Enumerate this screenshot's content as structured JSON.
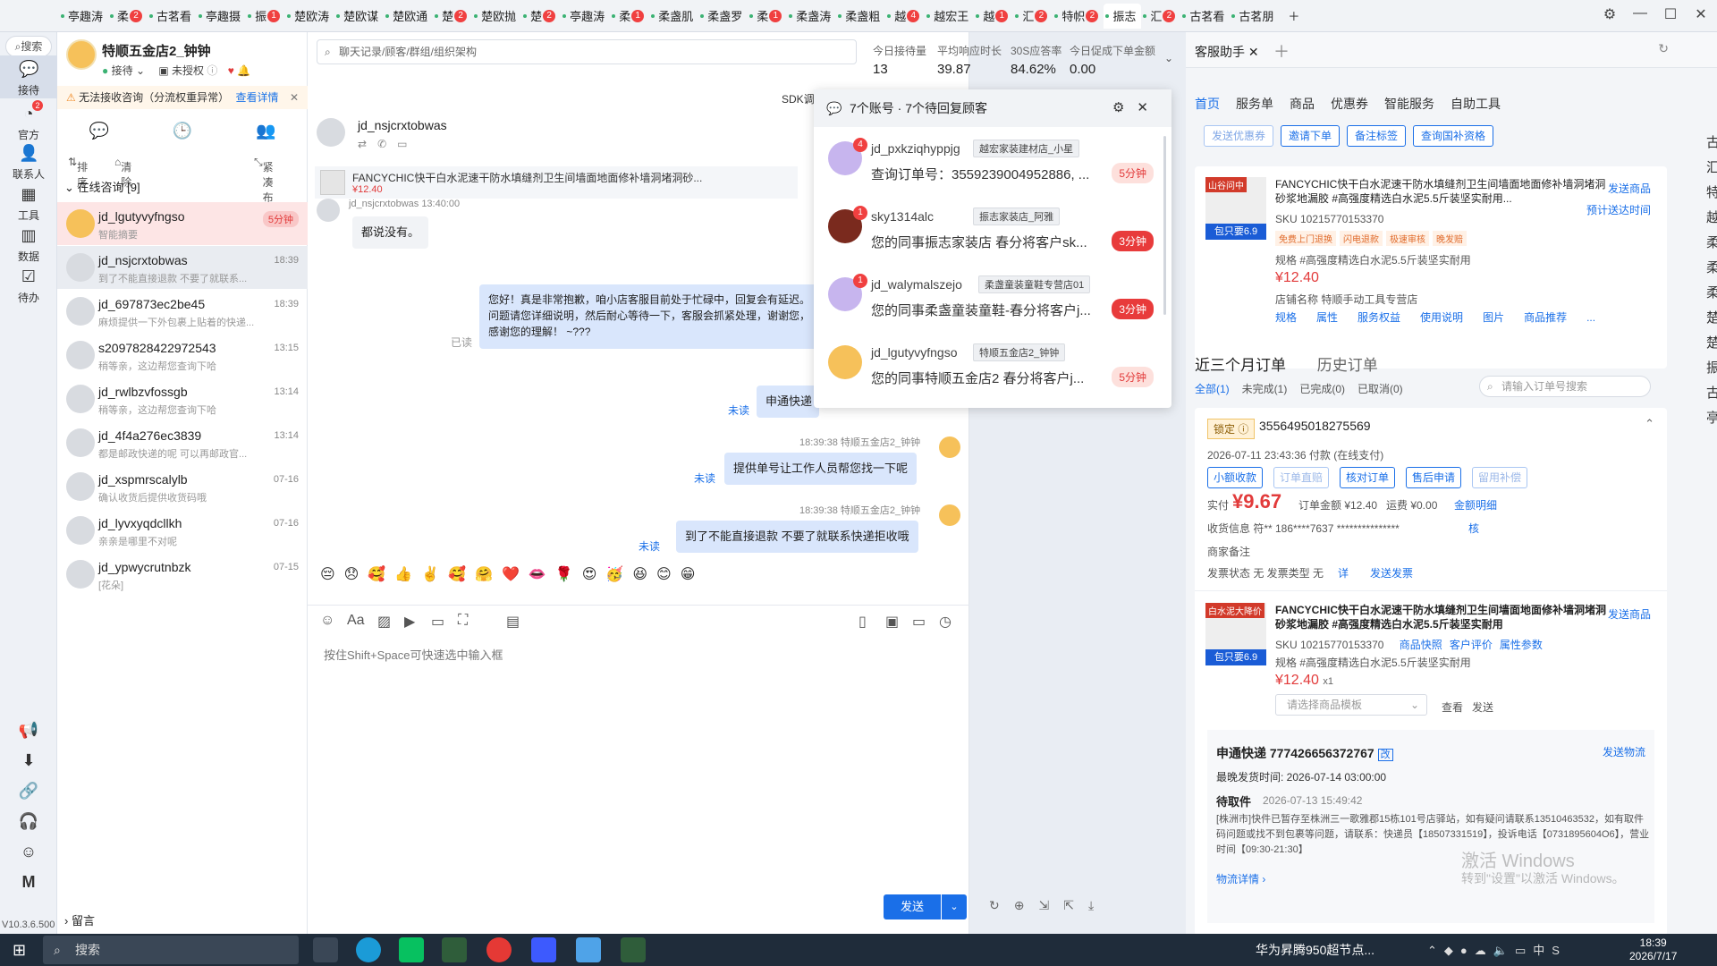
{
  "top_tabs": [
    {
      "label": "亭趣涛",
      "badge": ""
    },
    {
      "label": "柔",
      "badge": "2"
    },
    {
      "label": "古茗看",
      "badge": ""
    },
    {
      "label": "亭趣摄",
      "badge": ""
    },
    {
      "label": "振",
      "badge": "1"
    },
    {
      "label": "楚欧涛",
      "badge": ""
    },
    {
      "label": "楚欧谋",
      "badge": ""
    },
    {
      "label": "楚欧通",
      "badge": ""
    },
    {
      "label": "楚",
      "badge": "2"
    },
    {
      "label": "楚欧抛",
      "badge": ""
    },
    {
      "label": "楚",
      "badge": "2"
    },
    {
      "label": "亭趣涛",
      "badge": ""
    },
    {
      "label": "柔",
      "badge": "1"
    },
    {
      "label": "柔盏肌",
      "badge": ""
    },
    {
      "label": "柔盏罗",
      "badge": ""
    },
    {
      "label": "柔",
      "badge": "1"
    },
    {
      "label": "柔盏涛",
      "badge": ""
    },
    {
      "label": "柔盏粗",
      "badge": ""
    },
    {
      "label": "越",
      "badge": "4"
    },
    {
      "label": "越宏王",
      "badge": ""
    },
    {
      "label": "越",
      "badge": "1"
    },
    {
      "label": "汇",
      "badge": "2"
    },
    {
      "label": "特帜",
      "badge": "2"
    },
    {
      "label": "振志",
      "badge": ""
    },
    {
      "label": "汇",
      "badge": "2"
    },
    {
      "label": "古茗看",
      "badge": ""
    },
    {
      "label": "古茗朋",
      "badge": ""
    }
  ],
  "rail": {
    "search": "搜索",
    "items": [
      "接待",
      "官方",
      "联系人",
      "工具",
      "数据",
      "待办"
    ],
    "official_badge": "2",
    "version": "V10.3.6.500"
  },
  "shop": {
    "name": "特顺五金店2_钟钟",
    "status": "接待",
    "auth": "未授权",
    "warning": "无法接收咨询（分流权重异常）",
    "warning_link": "查看详情"
  },
  "list_ops": [
    "排序",
    "清除",
    "紧凑布局"
  ],
  "group_label": "在线咨询 [9]",
  "conversations": [
    {
      "name": "jd_lgutyvyfngso",
      "preview": "智能摘要",
      "time": "5分钟"
    },
    {
      "name": "jd_nsjcrxtobwas",
      "preview": "到了不能直接退款 不要了就联系...",
      "time": "18:39"
    },
    {
      "name": "jd_697873ec2be45",
      "preview": "麻烦提供一下外包裹上贴着的快递...",
      "time": "18:39"
    },
    {
      "name": "s2097828422972543",
      "preview": "稍等亲，这边帮您查询下哈",
      "time": "13:15"
    },
    {
      "name": "jd_rwlbzvfossgb",
      "preview": "稍等亲，这边帮您查询下哈",
      "time": "13:14"
    },
    {
      "name": "jd_4f4a276ec3839",
      "preview": "都是邮政快递的呢 可以再邮政官...",
      "time": "13:14"
    },
    {
      "name": "jd_xspmrscalylb",
      "preview": "确认收货后提供收货码哦",
      "time": "07-16"
    },
    {
      "name": "jd_lyvxyqdcllkh",
      "preview": "亲亲是哪里不对呢",
      "time": "07-16"
    },
    {
      "name": "jd_ypwycrutnbzk",
      "preview": "[花朵]",
      "time": "07-15"
    }
  ],
  "leave_msg": "留言",
  "chat": {
    "search_placeholder": "聊天记录/顾客/群组/组织架构",
    "customer": "jd_nsjcrxtobwas",
    "sdk": "SDK调",
    "product_title": "FANCYCHIC快干白水泥速干防水填缝剂卫生间墙面地面修补墙洞堵洞砂...",
    "product_price": "¥12.40",
    "stats": [
      {
        "label": "今日接待量",
        "value": "13"
      },
      {
        "label": "平均响应时长",
        "value": "39.87"
      },
      {
        "label": "30S应答率",
        "value": "84.62%"
      },
      {
        "label": "今日促成下单金额",
        "value": "0.00"
      }
    ],
    "msg1": "都说没有。",
    "msg1_meta": "jd_nsjcrxtobwas 13:40:00",
    "msg2": "您好！真是非常抱歉，咱小店客服目前处于忙碌中，回复会有延迟。问题请您详细说明，然后耐心等待一下，客服会抓紧处理，谢谢您，感谢您的理解！ ~???",
    "msg2_status": "已读",
    "msg3": "申通快递",
    "msg3_status": "未读",
    "msg4_meta": "18:39:38 特顺五金店2_钟钟",
    "msg4": "提供单号让工作人员帮您找一下呢",
    "msg4_status": "未读",
    "msg5_meta": "18:39:38 特顺五金店2_钟钟",
    "msg5": "到了不能直接退款 不要了就联系快递拒收哦",
    "msg5_status": "未读",
    "emojis": "😔😞🥰👍✌️🥰🤗❤️👄🌹😍🥳😆😊😁",
    "input_placeholder": "按住Shift+Space可快速选中输入框",
    "send": "发送"
  },
  "popup": {
    "title": "7个账号 · 7个待回复顾客",
    "items": [
      {
        "name": "jd_pxkziqhyppjg",
        "tag": "越宏家装建材店_小星",
        "text": "查询订单号：3559239004952886, ...",
        "time": "5分钟",
        "badge": "4"
      },
      {
        "name": "sky1314alc",
        "tag": "振志家装店_阿雅",
        "text": "您的同事振志家装店 春分将客户sk...",
        "time": "3分钟",
        "badge": "1"
      },
      {
        "name": "jd_walymalszejo",
        "tag": "柔盏童装童鞋专营店01",
        "text": "您的同事柔盏童装童鞋-春分将客户j...",
        "time": "3分钟",
        "badge": "1"
      },
      {
        "name": "jd_lgutyvyfngso",
        "tag": "特顺五金店2_钟钟",
        "text": "您的同事特顺五金店2 春分将客户j...",
        "time": "5分钟",
        "badge": ""
      }
    ]
  },
  "right": {
    "tab": "客服助手",
    "subnav": [
      "首页",
      "服务单",
      "商品",
      "优惠券",
      "智能服务",
      "自助工具"
    ],
    "chips": [
      "发送优惠券",
      "邀请下单",
      "备注标签",
      "查询国补资格"
    ],
    "product1": {
      "title": "FANCYCHIC快干白水泥速干防水填缝剂卫生间墙面地面修补墙洞堵洞砂浆地漏胶 #高强度精选白水泥5.5斤装坚实耐用...",
      "sku": "SKU 10215770153370",
      "tags": [
        "免费上门退换",
        "闪电退款",
        "极速审核",
        "晚发赔"
      ],
      "spec": "规格 #高强度精选白水泥5.5斤装坚实耐用",
      "price": "¥12.40",
      "shop": "店铺名称 特顺手动工具专营店",
      "links": [
        "规格",
        "属性",
        "服务权益",
        "使用说明",
        "图片",
        "商品推荐",
        "..."
      ],
      "send": "发送商品",
      "eta": "预计送达时间",
      "img_top": "山谷问中",
      "img_label": "包只要6.9"
    },
    "orders_title": "近三个月订单",
    "history_title": "历史订单",
    "order_filters": [
      "全部(1)",
      "未完成(1)",
      "已完成(0)",
      "已取消(0)"
    ],
    "order_search": "请输入订单号搜索",
    "order": {
      "lock": "锁定",
      "no": "3556495018275569",
      "time": "2026-07-11 23:43:36 付款 (在线支付)",
      "chips": [
        "小额收款",
        "订单直赔",
        "核对订单",
        "售后申请",
        "留用补偿"
      ],
      "paid_label": "实付",
      "paid": "¥9.67",
      "amount": "订单金额 ¥12.40",
      "freight": "运费 ¥0.00",
      "detail": "金额明细",
      "receiver": "收货信息  符**      186****7637      ***************",
      "verify": "核",
      "remark": "商家备注",
      "invoice": "发票状态 无    发票类型 无",
      "invoice_detail": "详",
      "invoice_send": "发送发票"
    },
    "product2": {
      "title": "FANCYCHIC快干白水泥速干防水填缝剂卫生间墙面地面修补墙洞堵洞砂浆地漏胶 #高强度精选白水泥5.5斤装坚实耐用",
      "sku": "SKU 10215770153370",
      "sku_links": [
        "商品快照",
        "客户评价",
        "属性参数"
      ],
      "spec": "规格 #高强度精选白水泥5.5斤装坚实耐用",
      "price": "¥12.40",
      "qty": "x1",
      "select": "请选择商品模板",
      "view": "查看",
      "send_short": "发送",
      "send": "发送商品",
      "img_top": "白水泥大降价",
      "img_label": "包只要6.9"
    },
    "logistics": {
      "title": "申通快递 777426656372767",
      "change": "改",
      "send": "发送物流",
      "deadline": "最晚发货时间:    2026-07-14 03:00:00",
      "status": "待取件",
      "status_time": "2026-07-13 15:49:42",
      "detail": "[株洲市]快件已暂存至株洲三一歌雅郡15栋101号店驿站，如有疑问请联系13510463532，如有取件码问题或找不到包裹等问题，请联系：快递员【18507331519】，投诉电话【0731895604O6】，营业时间【09:30-21:30】",
      "more": "物流详情"
    },
    "watermark1": "激活 Windows",
    "watermark2": "转到\"设置\"以激活 Windows。",
    "edge_chars": "古汇特越柔柔柔楚楚振古亭"
  },
  "taskbar": {
    "search": "搜索",
    "news": "华为昇腾950超节点...",
    "time": "18:39",
    "date": "2026/7/17",
    "ime": "中"
  }
}
